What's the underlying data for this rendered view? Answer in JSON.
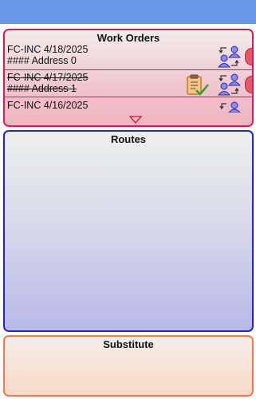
{
  "work_orders": {
    "title": "Work Orders",
    "items": [
      {
        "line1": "FC-INC 4/18/2025",
        "line2": "#### Address 0",
        "completed": false
      },
      {
        "line1": "FC-INC 4/17/2025",
        "line2": "#### Address 1",
        "completed": true
      },
      {
        "line1": "FC-INC 4/16/2025",
        "line2": "",
        "completed": false
      }
    ]
  },
  "routes": {
    "title": "Routes"
  },
  "substitute": {
    "title": "Substitute"
  },
  "colors": {
    "topbar": "#6a96e6",
    "work_orders_border": "#d81e4e",
    "routes_border": "#2222d8",
    "substitute_border": "#f07a4a"
  },
  "icons": [
    "swap-users-icon",
    "clipboard-check-icon",
    "expand-down-icon"
  ]
}
